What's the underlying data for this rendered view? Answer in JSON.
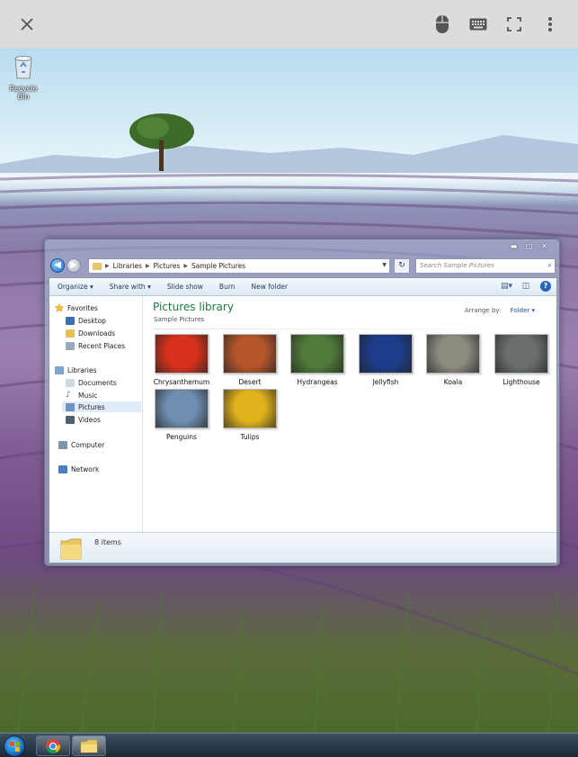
{
  "viewer": {
    "close_icon": "close-icon",
    "mouse_icon": "mouse-icon",
    "keyboard_icon": "keyboard-icon",
    "fullscreen_icon": "fullscreen-icon",
    "menu_icon": "more-vert-icon"
  },
  "desktop": {
    "recycle_bin_label": "Recycle Bin"
  },
  "explorer": {
    "address": {
      "crumbs": [
        "Libraries",
        "Pictures",
        "Sample Pictures"
      ]
    },
    "search_placeholder": "Search Sample Pictures",
    "toolbar": {
      "organize": "Organize ▾",
      "share_with": "Share with ▾",
      "slide_show": "Slide show",
      "burn": "Burn",
      "new_folder": "New folder"
    },
    "nav": {
      "favorites": "Favorites",
      "desktop": "Desktop",
      "downloads": "Downloads",
      "recent_places": "Recent Places",
      "libraries": "Libraries",
      "documents": "Documents",
      "music": "Music",
      "pictures": "Pictures",
      "videos": "Videos",
      "computer": "Computer",
      "network": "Network"
    },
    "content": {
      "title": "Pictures library",
      "subtitle": "Sample Pictures",
      "arrange_label": "Arrange by:",
      "arrange_value": "Folder ▾",
      "items": [
        {
          "name": "Chrysanthemum",
          "color": "#d8321c"
        },
        {
          "name": "Desert",
          "color": "#b5552a"
        },
        {
          "name": "Hydrangeas",
          "color": "#4f7a3a"
        },
        {
          "name": "Jellyfish",
          "color": "#1d3d8a"
        },
        {
          "name": "Koala",
          "color": "#8d8a80"
        },
        {
          "name": "Lighthouse",
          "color": "#6a6e6f"
        },
        {
          "name": "Penguins",
          "color": "#6e8fb0"
        },
        {
          "name": "Tulips",
          "color": "#e0b21c"
        }
      ]
    },
    "details": {
      "count": "8 items"
    }
  },
  "colors": {
    "library_title": "#1e7a3c",
    "accent_blue": "#1a55a8"
  }
}
